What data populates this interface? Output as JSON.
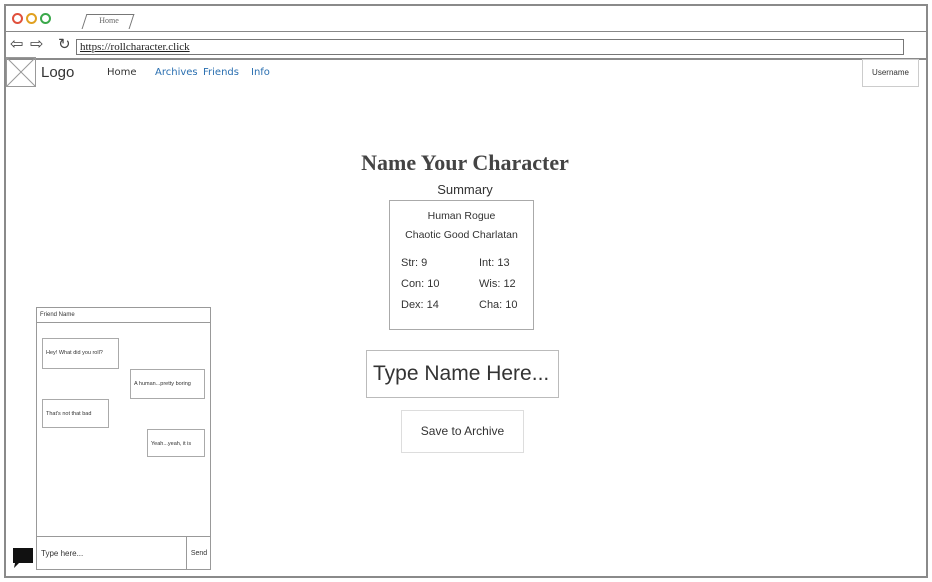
{
  "browser": {
    "tab_label": "Home",
    "url": "https://rollcharacter.click",
    "back_icon": "arrow-left-icon",
    "forward_icon": "arrow-right-icon",
    "reload_icon": "reload-icon"
  },
  "header": {
    "logo_text": "Logo",
    "nav": {
      "home": "Home",
      "archives": "Archives",
      "friends": "Friends",
      "info": "Info"
    },
    "username_button": "Username",
    "link_color": "#2a6fb0"
  },
  "main": {
    "title": "Name Your Character",
    "summary_label": "Summary",
    "summary": {
      "line1": "Human Rogue",
      "line2": "Chaotic Good Charlatan",
      "stats": {
        "str": "Str: 9",
        "con": "Con: 10",
        "dex": "Dex: 14",
        "int": "Int: 13",
        "wis": "Wis: 12",
        "cha": "Cha: 10"
      }
    },
    "name_input_placeholder": "Type Name Here...",
    "save_button": "Save to Archive"
  },
  "chat": {
    "header": "Friend Name",
    "messages": [
      "Hey! What did you roll?",
      "A human...pretty boring",
      "That's not that bad",
      "Yeah...yeah, it is"
    ],
    "input_placeholder": "Type here...",
    "send_button": "Send",
    "chat_icon": "chat-bubble-icon"
  }
}
